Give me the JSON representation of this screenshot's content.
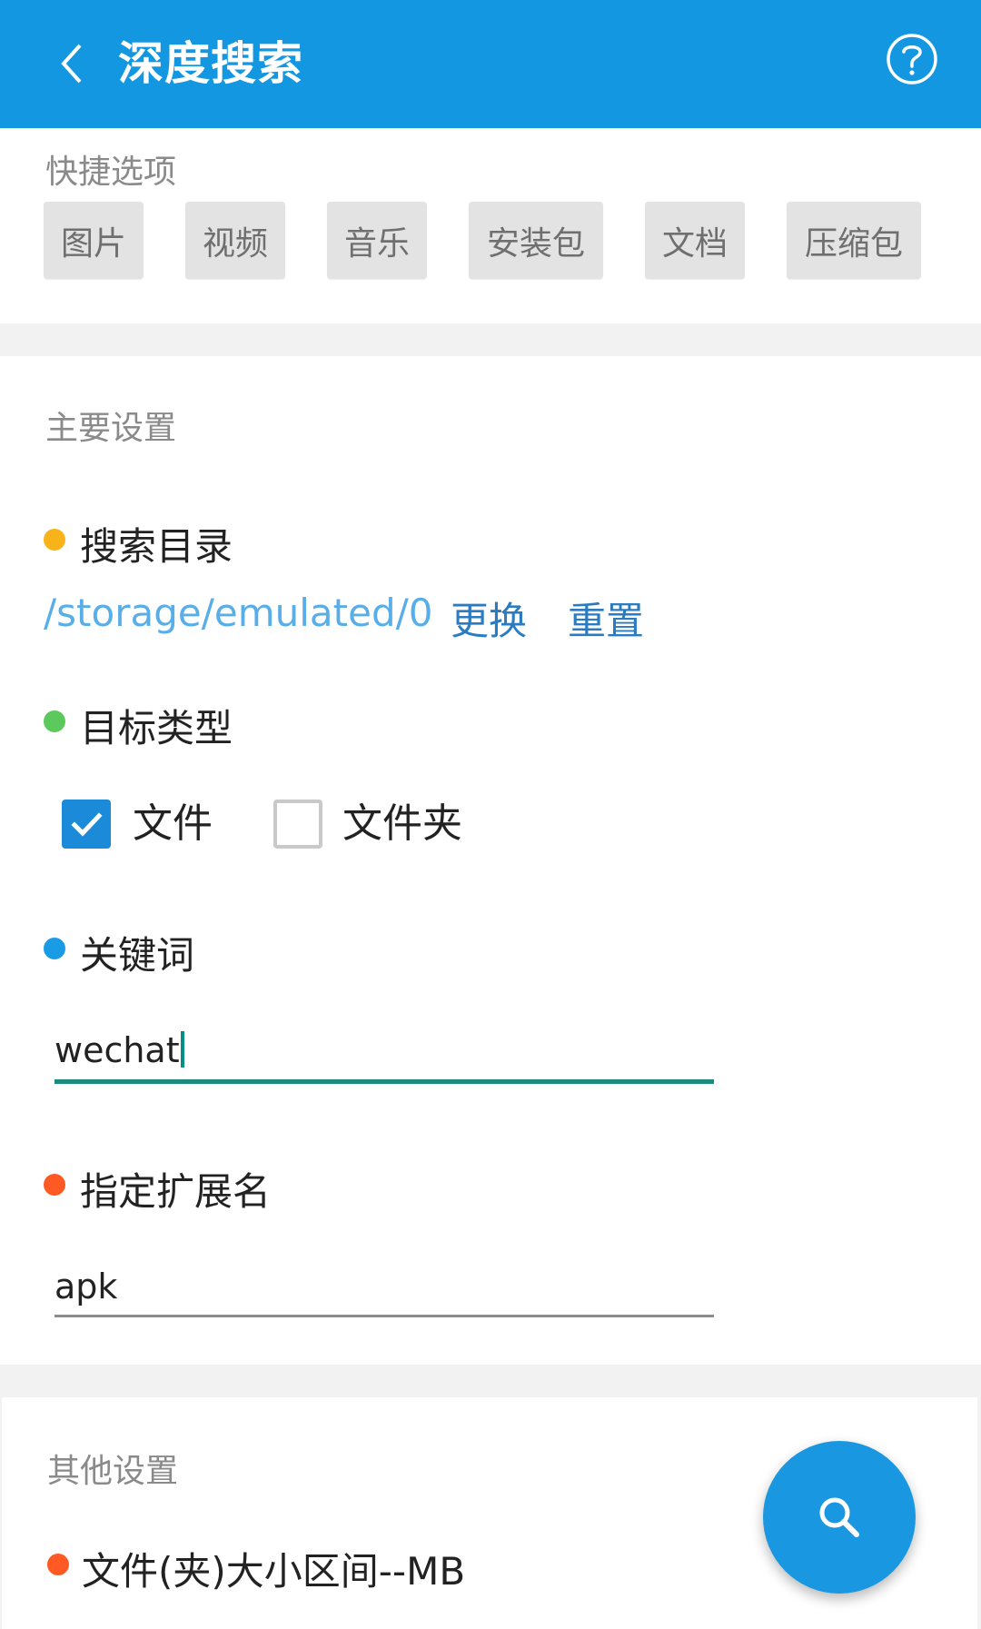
{
  "appbar": {
    "title": "深度搜索",
    "back_icon": "chevron-left-icon",
    "help_icon": "question-circle-icon",
    "background": "#1297e0"
  },
  "quick_options": {
    "label": "快捷选项",
    "chips": [
      "图片",
      "视频",
      "音乐",
      "安装包",
      "文档",
      "压缩包"
    ]
  },
  "main_settings": {
    "label": "主要设置",
    "search_dir": {
      "label": "搜索目录",
      "dot_color": "#f8b21a",
      "path": "/storage/emulated/0",
      "change_label": "更换",
      "reset_label": "重置"
    },
    "target_type": {
      "label": "目标类型",
      "dot_color": "#5bc95b",
      "options": [
        {
          "label": "文件",
          "checked": true
        },
        {
          "label": "文件夹",
          "checked": false
        }
      ]
    },
    "keyword": {
      "label": "关键词",
      "dot_color": "#1a9be6",
      "value": "wechat"
    },
    "extension": {
      "label": "指定扩展名",
      "dot_color": "#ff5a24",
      "value": "apk"
    }
  },
  "other_settings": {
    "label": "其他设置",
    "size_range": {
      "label": "文件(夹)大小区间--MB",
      "dot_color": "#ff5a24"
    }
  },
  "fab": {
    "icon": "search-icon",
    "background": "#1a97e1"
  }
}
